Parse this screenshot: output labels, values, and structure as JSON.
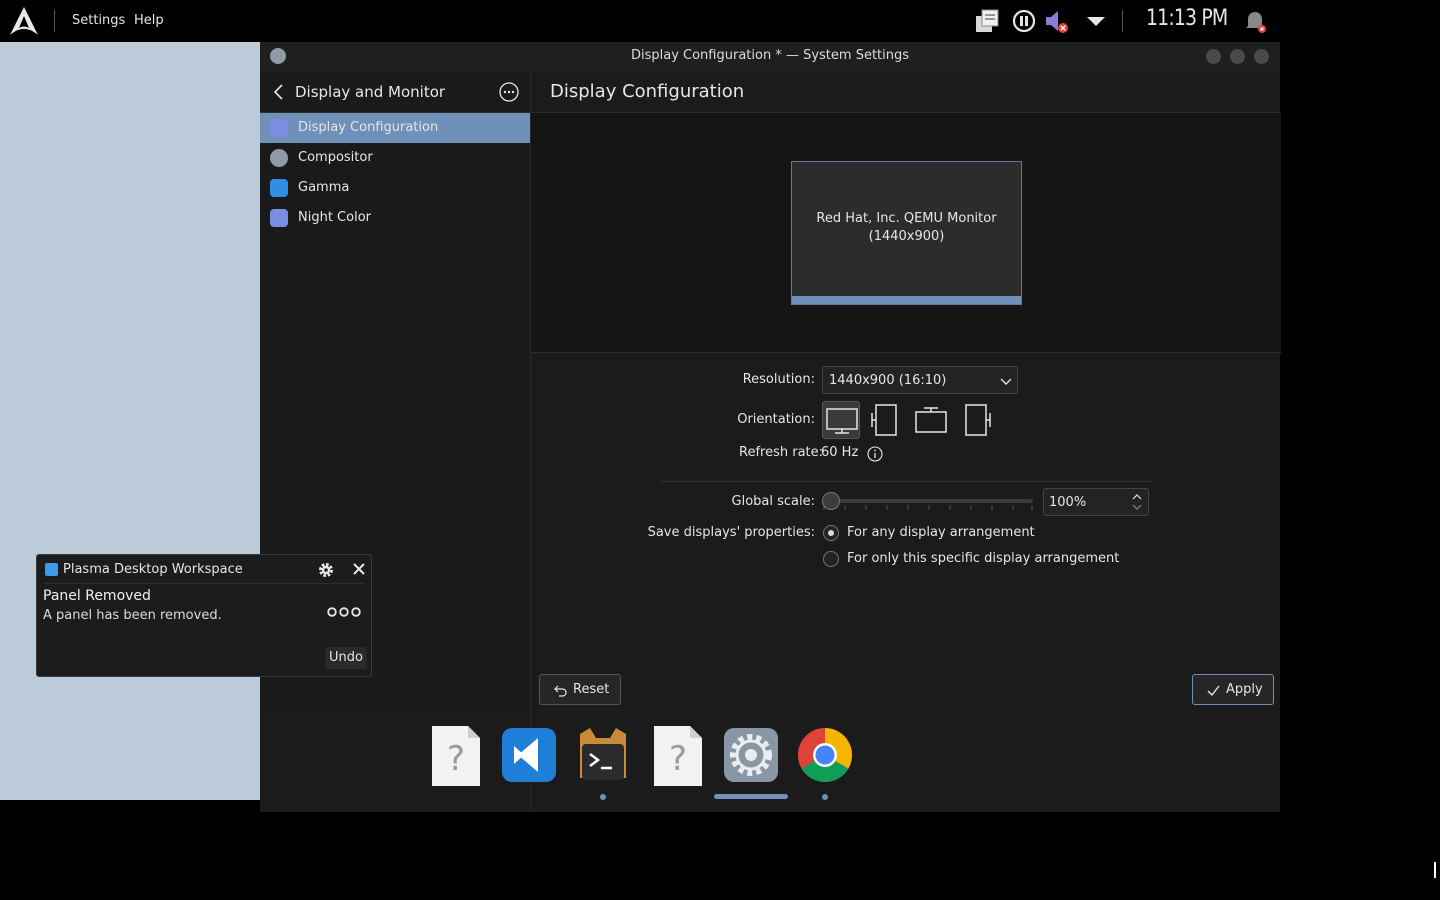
{
  "top_panel": {
    "menus": [
      "Settings",
      "Help"
    ],
    "clock": "11:13 PM"
  },
  "window": {
    "title": "Display Configuration * — System Settings"
  },
  "sidebar": {
    "title": "Display and Monitor",
    "items": [
      {
        "label": "Display Configuration",
        "icon": "display-icon",
        "color": "#7b8de0",
        "active": true
      },
      {
        "label": "Compositor",
        "icon": "compositor-icon",
        "color": "#8f9aa6",
        "active": false
      },
      {
        "label": "Gamma",
        "icon": "gamma-icon",
        "color": "#2f8fe8",
        "active": false
      },
      {
        "label": "Night Color",
        "icon": "night-color-icon",
        "color": "#7b8de0",
        "active": false
      }
    ]
  },
  "content": {
    "title": "Display Configuration",
    "monitor": {
      "name": "Red Hat, Inc. QEMU Monitor",
      "resolution": "(1440x900)"
    },
    "resolution_label": "Resolution:",
    "resolution_value": "1440x900 (16:10)",
    "orientation_label": "Orientation:",
    "refresh_rate_label": "Refresh rate:",
    "refresh_rate_value": "60 Hz",
    "global_scale_label": "Global scale:",
    "global_scale_value": "100%",
    "save_label": "Save displays' properties:",
    "save_options": [
      {
        "label": "For any display arrangement",
        "checked": true
      },
      {
        "label": "For only this specific display arrangement",
        "checked": false
      }
    ],
    "reset_label": "Reset",
    "apply_label": "Apply"
  },
  "notification": {
    "app_name": "Plasma Desktop Workspace",
    "title": "Panel Removed",
    "body": "A panel has been removed.",
    "undo_label": "Undo"
  },
  "dock": {
    "items": [
      "unknown-file-icon",
      "vscode-icon",
      "terminal-icon",
      "unknown-file-icon",
      "system-settings-icon",
      "chrome-icon"
    ]
  },
  "colors": {
    "accent": "#6f90b8",
    "background": "#1b1b1b",
    "wallpaper": "#bccbd9"
  }
}
